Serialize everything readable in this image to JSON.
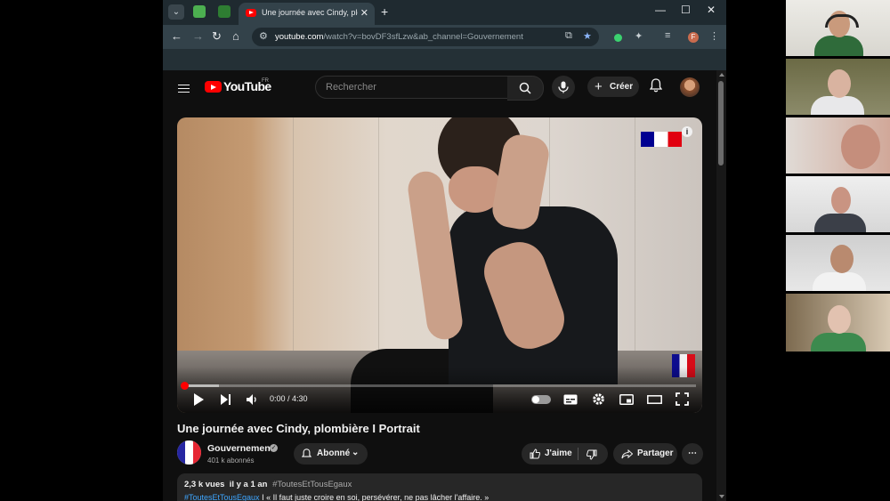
{
  "browser": {
    "tab_title": "Une journée avec Cindy, plombi",
    "url_host": "youtube.com",
    "url_rest": "/watch?v=bovDF3sfLzw&ab_channel=Gouvernement",
    "profile_initial": "F"
  },
  "youtube": {
    "logo": "YouTube",
    "region": "FR",
    "search_placeholder": "Rechercher",
    "create_label": "Créer",
    "video": {
      "title": "Une journée avec Cindy, plombière I Portrait",
      "time": "0:00 / 4:30",
      "progress_buffered": 0.07,
      "progress_played": 0.0
    },
    "channel": {
      "name": "Gouvernement",
      "subscribers": "401 k abonnés",
      "subscribed_label": "Abonné"
    },
    "actions": {
      "like": "J'aime",
      "share": "Partager"
    },
    "description": {
      "views": "2,3 k vues",
      "age": "il y a 1 an",
      "hashtag": "#ToutesEtTousEgaux",
      "line_hashtag": "#ToutesEtTousEgaux",
      "line_text": " I « Il faut juste croire en soi, persévérer, ne pas lâcher l'affaire. »"
    }
  },
  "colors": {
    "youtube_red": "#ff0000",
    "link_blue": "#3ea6ff",
    "browser_frame": "#33424a"
  },
  "icons": [
    "menu-icon",
    "search-icon",
    "mic-icon",
    "plus-icon",
    "bell-icon",
    "play-icon",
    "next-icon",
    "volume-icon",
    "subtitles-icon",
    "settings-icon",
    "miniplayer-icon",
    "theater-icon",
    "fullscreen-icon",
    "like-icon",
    "dislike-icon",
    "share-icon",
    "more-icon"
  ]
}
